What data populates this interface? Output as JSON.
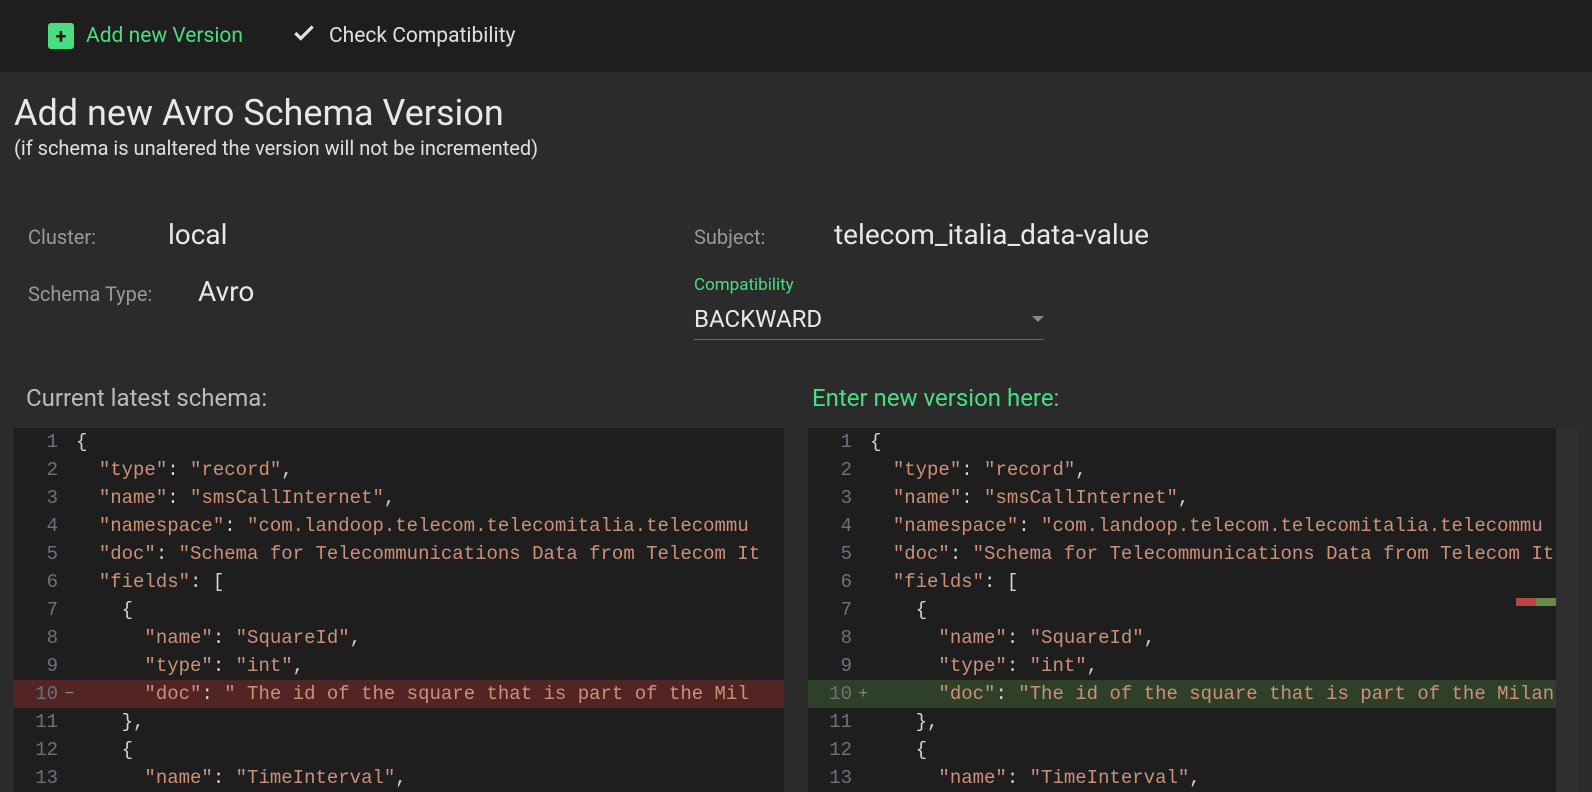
{
  "toolbar": {
    "add_label": "Add new Version",
    "check_label": "Check Compatibility"
  },
  "header": {
    "title": "Add new Avro Schema Version",
    "subtitle": "(if schema is unaltered the version will not be incremented)"
  },
  "meta": {
    "cluster_label": "Cluster:",
    "cluster_value": "local",
    "subject_label": "Subject:",
    "subject_value": "telecom_italia_data-value",
    "schema_type_label": "Schema Type:",
    "schema_type_value": "Avro",
    "compat_label": "Compatibility",
    "compat_value": "BACKWARD"
  },
  "panels": {
    "current_title": "Current latest schema:",
    "new_title": "Enter new version here:"
  },
  "schema_left": [
    {
      "n": 1,
      "indent": 0,
      "tokens": [
        {
          "t": "p",
          "v": "{"
        }
      ]
    },
    {
      "n": 2,
      "indent": 1,
      "tokens": [
        {
          "t": "k",
          "v": "\"type\""
        },
        {
          "t": "p",
          "v": ": "
        },
        {
          "t": "s",
          "v": "\"record\""
        },
        {
          "t": "p",
          "v": ","
        }
      ]
    },
    {
      "n": 3,
      "indent": 1,
      "tokens": [
        {
          "t": "k",
          "v": "\"name\""
        },
        {
          "t": "p",
          "v": ": "
        },
        {
          "t": "s",
          "v": "\"smsCallInternet\""
        },
        {
          "t": "p",
          "v": ","
        }
      ]
    },
    {
      "n": 4,
      "indent": 1,
      "tokens": [
        {
          "t": "k",
          "v": "\"namespace\""
        },
        {
          "t": "p",
          "v": ": "
        },
        {
          "t": "s",
          "v": "\"com.landoop.telecom.telecomitalia.telecommu"
        }
      ]
    },
    {
      "n": 5,
      "indent": 1,
      "tokens": [
        {
          "t": "k",
          "v": "\"doc\""
        },
        {
          "t": "p",
          "v": ": "
        },
        {
          "t": "s",
          "v": "\"Schema for Telecommunications Data from Telecom It"
        }
      ]
    },
    {
      "n": 6,
      "indent": 1,
      "tokens": [
        {
          "t": "k",
          "v": "\"fields\""
        },
        {
          "t": "p",
          "v": ": ["
        }
      ]
    },
    {
      "n": 7,
      "indent": 2,
      "tokens": [
        {
          "t": "p",
          "v": "{"
        }
      ]
    },
    {
      "n": 8,
      "indent": 3,
      "tokens": [
        {
          "t": "k",
          "v": "\"name\""
        },
        {
          "t": "p",
          "v": ": "
        },
        {
          "t": "s",
          "v": "\"SquareId\""
        },
        {
          "t": "p",
          "v": ","
        }
      ]
    },
    {
      "n": 9,
      "indent": 3,
      "tokens": [
        {
          "t": "k",
          "v": "\"type\""
        },
        {
          "t": "p",
          "v": ": "
        },
        {
          "t": "s",
          "v": "\"int\""
        },
        {
          "t": "p",
          "v": ","
        }
      ]
    },
    {
      "n": 10,
      "indent": 3,
      "diff": "del",
      "tokens": [
        {
          "t": "k",
          "v": "\"doc\""
        },
        {
          "t": "p",
          "v": ": "
        },
        {
          "t": "s",
          "v": "\" The id of the square that is part of the Mil"
        }
      ]
    },
    {
      "n": 11,
      "indent": 2,
      "tokens": [
        {
          "t": "p",
          "v": "},"
        }
      ]
    },
    {
      "n": 12,
      "indent": 2,
      "tokens": [
        {
          "t": "p",
          "v": "{"
        }
      ]
    },
    {
      "n": 13,
      "indent": 3,
      "tokens": [
        {
          "t": "k",
          "v": "\"name\""
        },
        {
          "t": "p",
          "v": ": "
        },
        {
          "t": "s",
          "v": "\"TimeInterval\""
        },
        {
          "t": "p",
          "v": ","
        }
      ]
    }
  ],
  "schema_right": [
    {
      "n": 1,
      "indent": 0,
      "tokens": [
        {
          "t": "p",
          "v": "{"
        }
      ]
    },
    {
      "n": 2,
      "indent": 1,
      "tokens": [
        {
          "t": "k",
          "v": "\"type\""
        },
        {
          "t": "p",
          "v": ": "
        },
        {
          "t": "s",
          "v": "\"record\""
        },
        {
          "t": "p",
          "v": ","
        }
      ]
    },
    {
      "n": 3,
      "indent": 1,
      "tokens": [
        {
          "t": "k",
          "v": "\"name\""
        },
        {
          "t": "p",
          "v": ": "
        },
        {
          "t": "s",
          "v": "\"smsCallInternet\""
        },
        {
          "t": "p",
          "v": ","
        }
      ]
    },
    {
      "n": 4,
      "indent": 1,
      "tokens": [
        {
          "t": "k",
          "v": "\"namespace\""
        },
        {
          "t": "p",
          "v": ": "
        },
        {
          "t": "s",
          "v": "\"com.landoop.telecom.telecomitalia.telecommu"
        }
      ]
    },
    {
      "n": 5,
      "indent": 1,
      "tokens": [
        {
          "t": "k",
          "v": "\"doc\""
        },
        {
          "t": "p",
          "v": ": "
        },
        {
          "t": "s",
          "v": "\"Schema for Telecommunications Data from Telecom It"
        }
      ]
    },
    {
      "n": 6,
      "indent": 1,
      "tokens": [
        {
          "t": "k",
          "v": "\"fields\""
        },
        {
          "t": "p",
          "v": ": ["
        }
      ]
    },
    {
      "n": 7,
      "indent": 2,
      "tokens": [
        {
          "t": "p",
          "v": "{"
        }
      ]
    },
    {
      "n": 8,
      "indent": 3,
      "tokens": [
        {
          "t": "k",
          "v": "\"name\""
        },
        {
          "t": "p",
          "v": ": "
        },
        {
          "t": "s",
          "v": "\"SquareId\""
        },
        {
          "t": "p",
          "v": ","
        }
      ]
    },
    {
      "n": 9,
      "indent": 3,
      "tokens": [
        {
          "t": "k",
          "v": "\"type\""
        },
        {
          "t": "p",
          "v": ": "
        },
        {
          "t": "s",
          "v": "\"int\""
        },
        {
          "t": "p",
          "v": ","
        }
      ]
    },
    {
      "n": 10,
      "indent": 3,
      "diff": "add",
      "tokens": [
        {
          "t": "k",
          "v": "\"doc\""
        },
        {
          "t": "p",
          "v": ": "
        },
        {
          "t": "s",
          "v": "\"The id of the square that is part of the Milan"
        }
      ]
    },
    {
      "n": 11,
      "indent": 2,
      "tokens": [
        {
          "t": "p",
          "v": "},"
        }
      ]
    },
    {
      "n": 12,
      "indent": 2,
      "tokens": [
        {
          "t": "p",
          "v": "{"
        }
      ]
    },
    {
      "n": 13,
      "indent": 3,
      "tokens": [
        {
          "t": "k",
          "v": "\"name\""
        },
        {
          "t": "p",
          "v": ": "
        },
        {
          "t": "s",
          "v": "\"TimeInterval\""
        },
        {
          "t": "p",
          "v": ","
        }
      ]
    }
  ]
}
